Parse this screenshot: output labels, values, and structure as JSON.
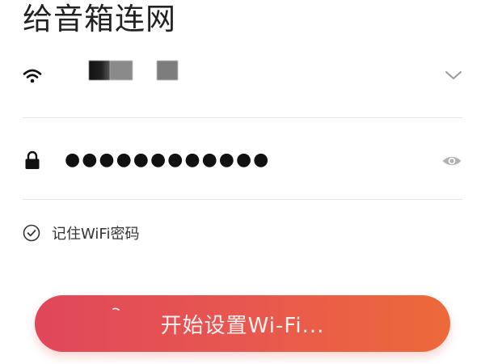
{
  "header": {
    "title": "给音箱连网"
  },
  "wifi": {
    "network_name": "",
    "icon": "wifi-icon",
    "dropdown_icon": "chevron-down-icon"
  },
  "password": {
    "value": "●●●●●●●●●●●●",
    "icon": "lock-icon",
    "toggle_icon": "eye-icon"
  },
  "remember": {
    "label": "记住WiFi密码",
    "checked": true,
    "icon": "check-circle-icon"
  },
  "start_button": {
    "label": "开始设置Wi-Fi...",
    "gradient_start": "#e0475a",
    "gradient_end": "#ec6a3a",
    "loading": true
  },
  "colors": {
    "text_primary": "#222222",
    "divider": "#e6e6e6",
    "icon_muted": "#b0b0b0"
  }
}
